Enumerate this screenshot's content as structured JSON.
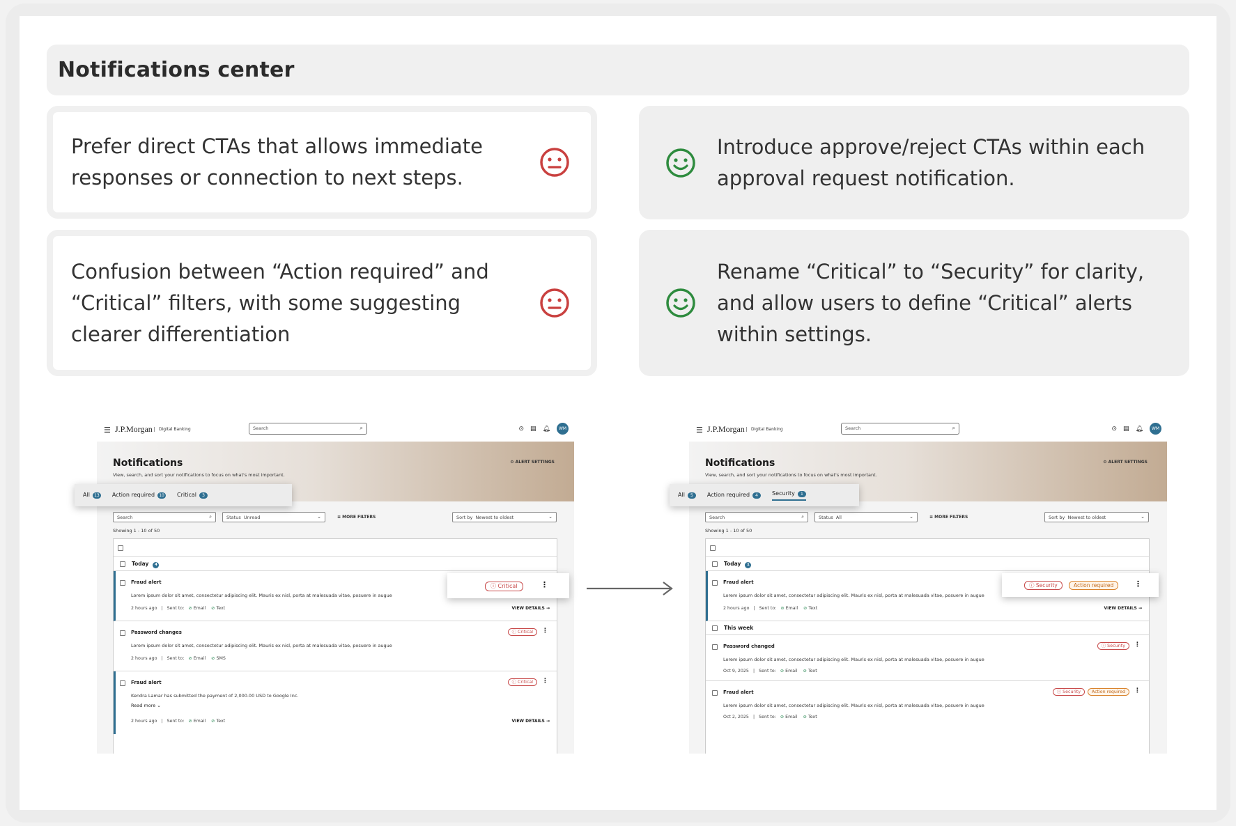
{
  "section_title": "Notifications center",
  "findings": [
    {
      "text": "Prefer direct CTAs that allows immediate responses or connection to next steps.",
      "icon": "neutral-face-icon"
    },
    {
      "text": "Confusion between “Action required” and “Critical” filters, with some suggesting clearer differentiation",
      "icon": "neutral-face-icon"
    }
  ],
  "recommendations": [
    {
      "text": "Introduce approve/reject CTAs within each approval request notification.",
      "icon": "smiley-face-icon"
    },
    {
      "text": "Rename “Critical” to “Security” for clarity, and allow users to define “Critical” alerts within settings.",
      "icon": "smiley-face-icon"
    }
  ],
  "colors": {
    "bad": "#c9403f",
    "good": "#2e8b3e",
    "accent": "#2f6f91"
  },
  "common": {
    "brand": "J.P.Morgan",
    "brand_sub": "Digital Banking",
    "search_placeholder": "Search",
    "page_title": "Notifications",
    "page_subtitle": "View, search, and sort your notifications to focus on what's most important.",
    "alert_settings": "ALERT SETTINGS",
    "avatar": "WM",
    "filter_search": "Search",
    "status_label": "Status",
    "more_filters": "MORE FILTERS",
    "sort_label": "Sort by",
    "sort_value": "Newest to oldest",
    "showing": "Showing 1 - 10 of 50",
    "lorem": "Lorem ipsum dolor sit amet, consectetur adipiscing elit. Mauris ex nisl, porta at malesuada vitae, posuere in augue",
    "sent_to": "Sent to:",
    "view_details": "VIEW DETAILS",
    "today": "Today"
  },
  "before": {
    "tabs": [
      {
        "label": "All",
        "count": "13"
      },
      {
        "label": "Action required",
        "count": "10"
      },
      {
        "label": "Critical",
        "count": "3"
      }
    ],
    "status_value": "Unread",
    "rows": [
      {
        "title": "Fraud alert",
        "time": "2 hours ago",
        "ch1": "Email",
        "ch2": "Text",
        "tag": "Critical"
      },
      {
        "title": "Password changes",
        "time": "2 hours ago",
        "ch1": "Email",
        "ch2": "SMS",
        "tag": "Critical"
      },
      {
        "title": "Fraud alert",
        "desc": "Kendra Lamar has submitted the payment of 2,000.00 USD to Google Inc.",
        "read_more": "Read more",
        "time": "2 hours ago",
        "ch1": "Email",
        "ch2": "Text",
        "tag": "Critical"
      }
    ]
  },
  "after": {
    "tabs": [
      {
        "label": "All",
        "count": "5"
      },
      {
        "label": "Action required",
        "count": "4"
      },
      {
        "label": "Security",
        "count": "1"
      }
    ],
    "status_value": "All",
    "this_week": "This week",
    "rows": [
      {
        "title": "Fraud alert",
        "time": "2 hours ago",
        "ch1": "Email",
        "ch2": "Text",
        "tag1": "Security",
        "tag2": "Action required"
      },
      {
        "title": "Password changed",
        "time": "Oct 9, 2025",
        "ch1": "Email",
        "ch2": "Text",
        "tag1": "Security"
      },
      {
        "title": "Fraud alert",
        "time": "Oct 2, 2025",
        "ch1": "Email",
        "ch2": "Text",
        "tag1": "Security",
        "tag2": "Action required"
      }
    ]
  }
}
